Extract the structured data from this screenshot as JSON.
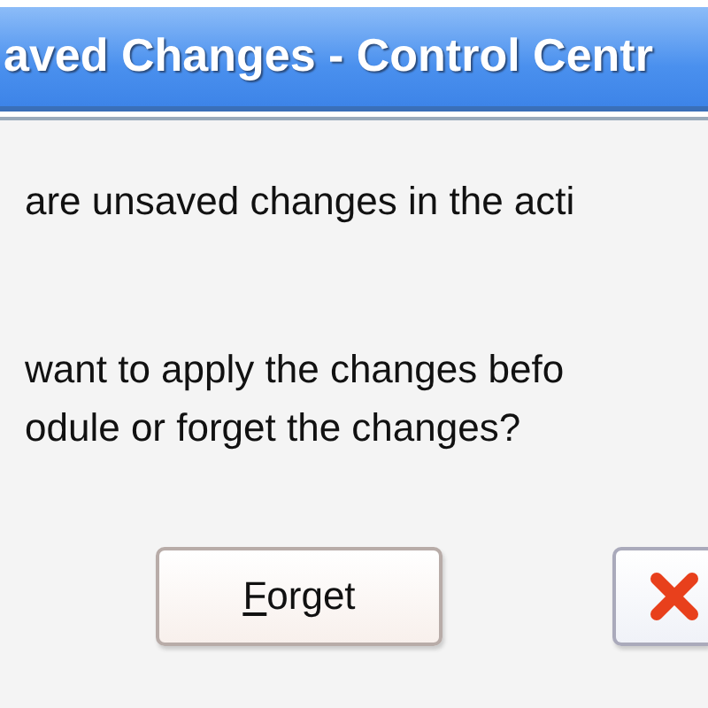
{
  "window": {
    "title": "aved Changes - Control Centr"
  },
  "message": {
    "lines": [
      "are unsaved changes in the acti",
      "want to apply the changes befo",
      "odule or forget the changes?"
    ]
  },
  "buttons": [
    {
      "kind": "text",
      "label": "Forget"
    },
    {
      "kind": "cancel"
    }
  ]
}
